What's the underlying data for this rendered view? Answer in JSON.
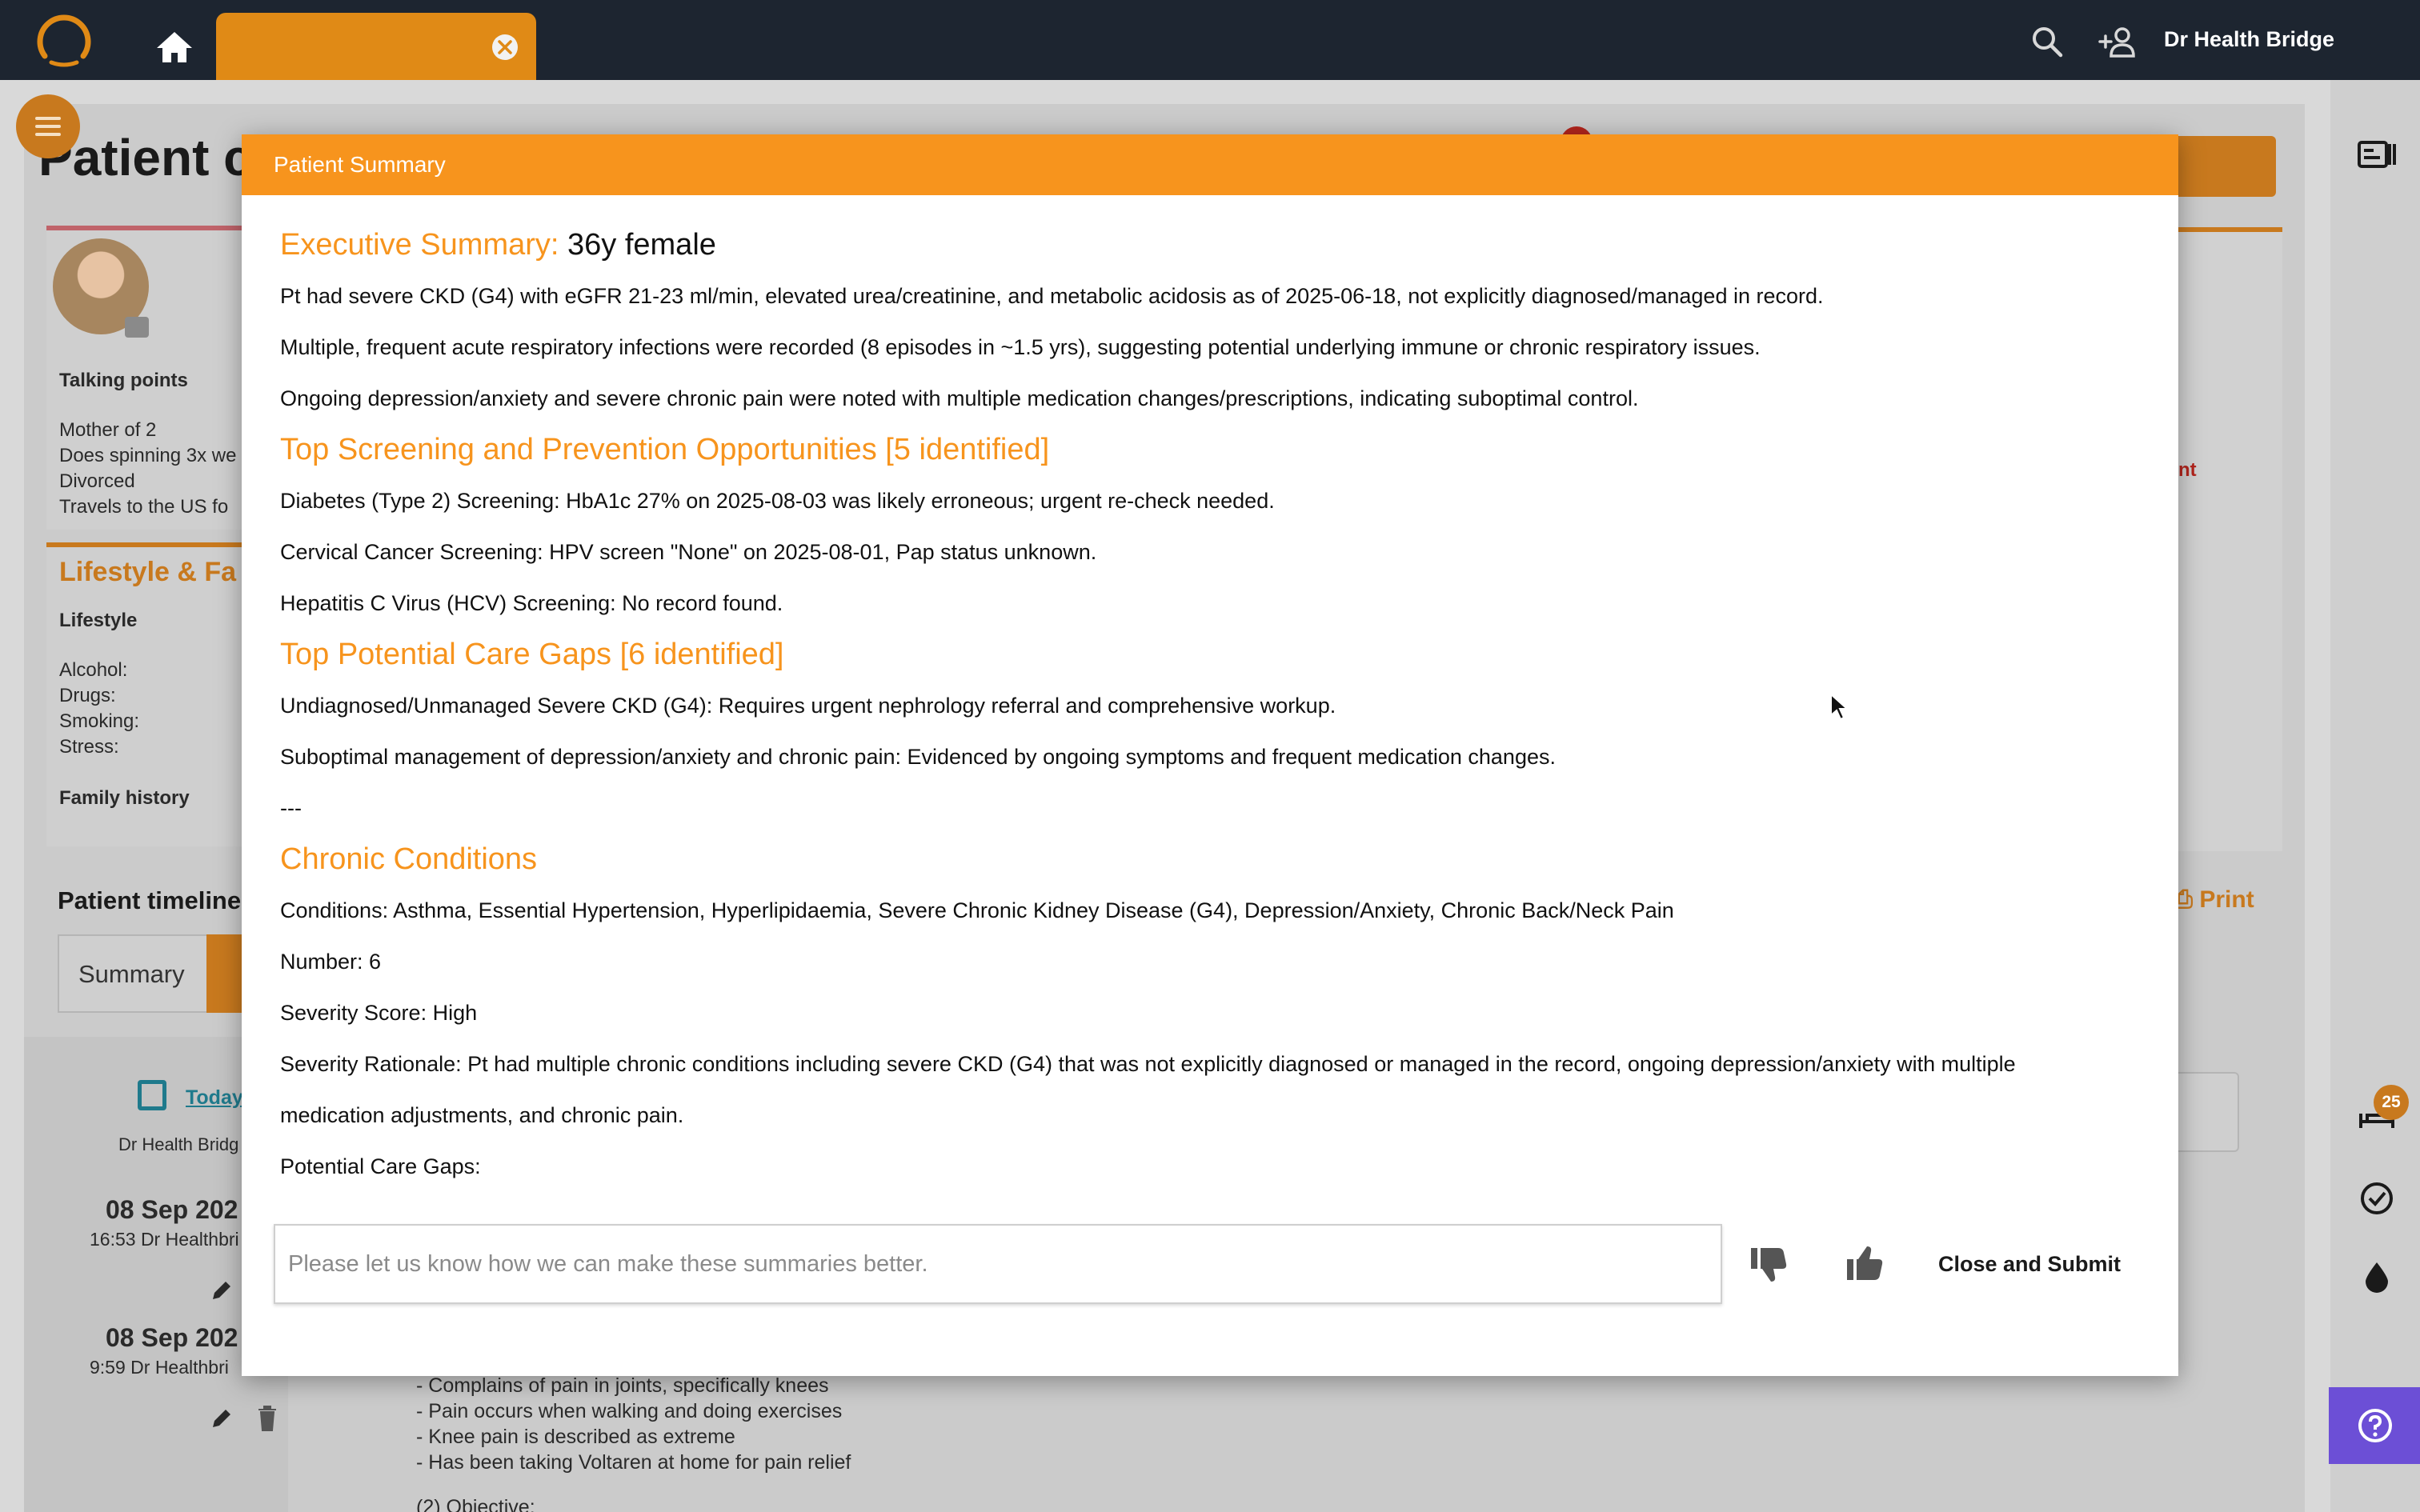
{
  "topbar": {
    "user_name": "Dr Health Bridge"
  },
  "background": {
    "page_title": "Patient c",
    "talking_points_label": "Talking points",
    "talking_points": [
      "Mother of 2",
      "Does spinning 3x we",
      "Divorced",
      "Travels to the US fo"
    ],
    "lifestyle_title": "Lifestyle & Fa",
    "lifestyle_label": "Lifestyle",
    "lifestyle_items": [
      "Alcohol:",
      "Drugs:",
      "Smoking:",
      "Stress:"
    ],
    "family_history_label": "Family history",
    "timeline_title": "Patient timeline",
    "tab_summary": "Summary",
    "today_link": "Today",
    "doctor_short": "Dr Health Bridg",
    "entries": [
      {
        "date": "08 Sep 202",
        "meta": "16:53 Dr Healthbri"
      },
      {
        "date": "08 Sep 202",
        "meta": "9:59 Dr Healthbri"
      }
    ],
    "print_label": "Print",
    "alert_fragment": "nt",
    "notification_count": "25",
    "notes": [
      "- Complains of pain in joints, specifically knees",
      "- Pain occurs when walking and doing exercises",
      "- Knee pain is described as extreme",
      "- Has been taking Voltaren at home for pain relief",
      "(2) Objective:"
    ]
  },
  "modal": {
    "title": "Patient Summary",
    "exec_heading": "Executive Summary:",
    "exec_demo": "36y female",
    "exec_bullets": [
      "Pt had severe CKD (G4) with eGFR 21-23 ml/min, elevated urea/creatinine, and metabolic acidosis as of 2025-06-18, not explicitly diagnosed/managed in record.",
      "Multiple, frequent acute respiratory infections were recorded (8 episodes in ~1.5 yrs), suggesting potential underlying immune or chronic respiratory issues.",
      "Ongoing depression/anxiety and severe chronic pain were noted with multiple medication changes/prescriptions, indicating suboptimal control."
    ],
    "screening_heading": "Top Screening and Prevention Opportunities [5 identified]",
    "screening_bullets": [
      "Diabetes (Type 2) Screening: HbA1c 27% on 2025-08-03 was likely erroneous; urgent re-check needed.",
      "Cervical Cancer Screening: HPV screen \"None\" on 2025-08-01, Pap status unknown.",
      "Hepatitis C Virus (HCV) Screening: No record found."
    ],
    "gaps_heading": "Top Potential Care Gaps [6 identified]",
    "gaps_bullets": [
      "Undiagnosed/Unmanaged Severe CKD (G4): Requires urgent nephrology referral and comprehensive workup.",
      "Suboptimal management of depression/anxiety and chronic pain: Evidenced by ongoing symptoms and frequent medication changes."
    ],
    "separator": "---",
    "chronic_heading": "Chronic Conditions",
    "chronic_bullets": [
      "Conditions: Asthma, Essential Hypertension, Hyperlipidaemia, Severe Chronic Kidney Disease (G4), Depression/Anxiety, Chronic Back/Neck Pain",
      "Number: 6",
      "Severity Score: High",
      "Severity Rationale: Pt had multiple chronic conditions including severe CKD (G4) that was not explicitly diagnosed or managed in the record, ongoing depression/anxiety with multiple medication adjustments, and chronic pain.",
      "Potential Care Gaps:"
    ],
    "feedback_placeholder": "Please let us know how we can make these summaries better.",
    "close_submit_label": "Close and Submit"
  },
  "colors": {
    "brand_orange": "#f7941d",
    "topbar": "#1d2530",
    "help_purple": "#6c4fd6"
  }
}
